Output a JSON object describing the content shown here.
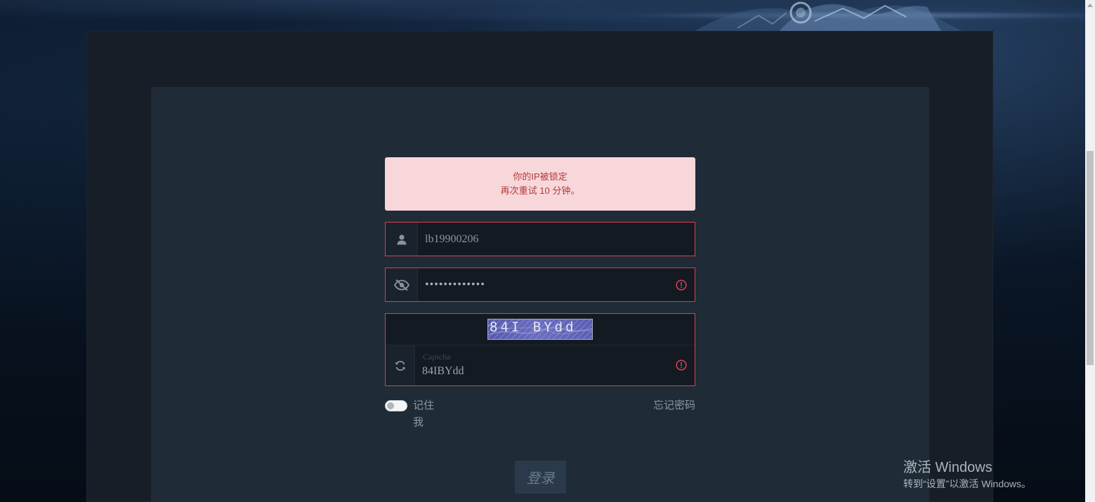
{
  "alert": {
    "line1": "你的IP被锁定",
    "line2": "再次重试 10 分钟。"
  },
  "username": {
    "value": "lb19900206",
    "icon": "user-icon"
  },
  "password": {
    "value": "•••••••••••••",
    "icon": "eye-slash-icon",
    "error_icon": "exclamation-circle-icon"
  },
  "captcha": {
    "image_text": "84I BYdd",
    "label": "Captcha",
    "value": "84IBYdd",
    "refresh_icon": "refresh-icon",
    "error_icon": "exclamation-circle-icon"
  },
  "remember_me": {
    "label": "记住我",
    "checked": false
  },
  "forgot_password": {
    "label": "忘记密码"
  },
  "login_button": {
    "label": "登录"
  },
  "watermark": {
    "title": "激活 Windows",
    "subtitle": "转到“设置”以激活 Windows。"
  },
  "colors": {
    "error_border": "#d6434f",
    "alert_bg": "#f8d7da",
    "alert_text": "#b23a3a",
    "panel_bg": "#1f2b37"
  }
}
